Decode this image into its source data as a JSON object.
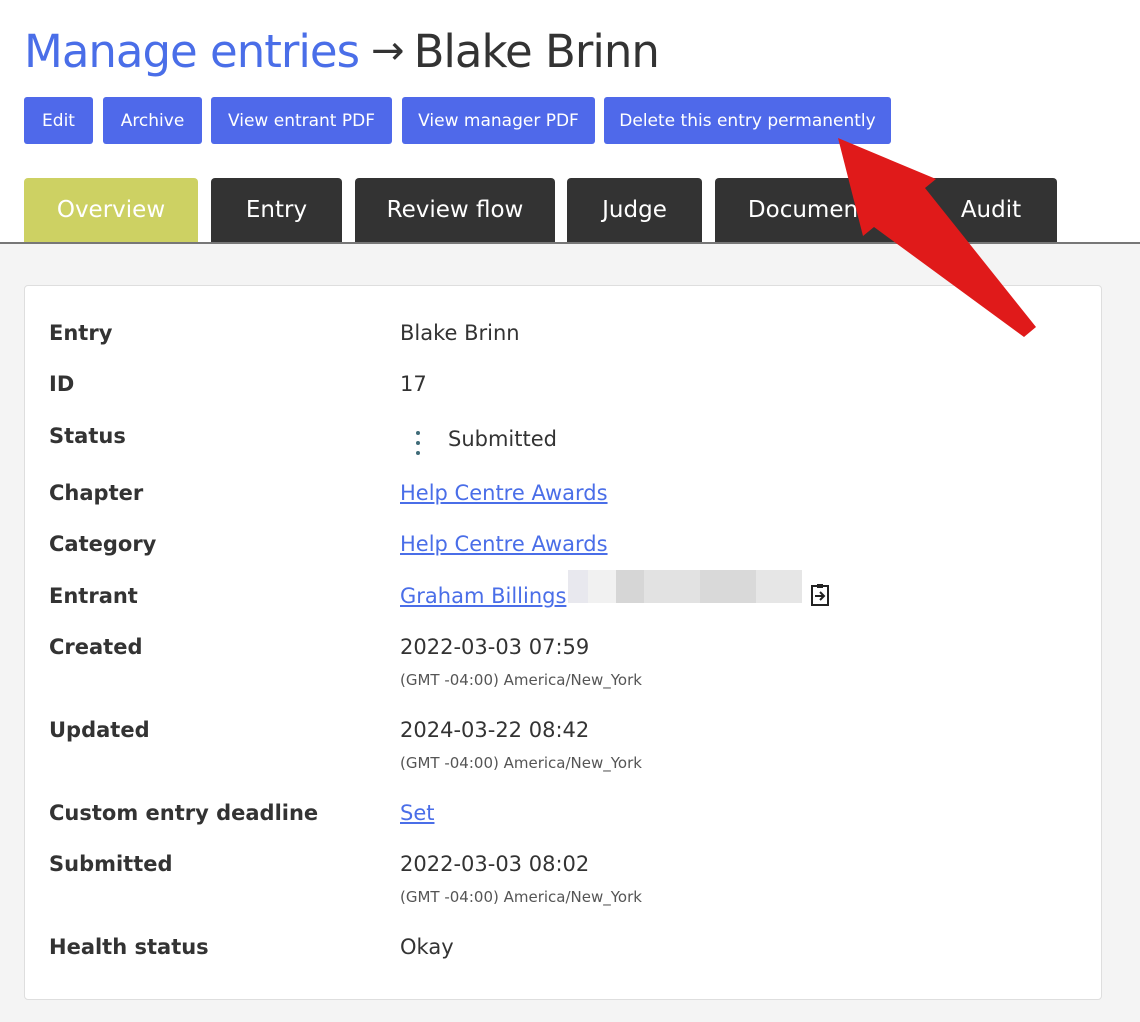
{
  "header": {
    "breadcrumb_label": "Manage entries",
    "separator": "→",
    "entry_name": "Blake Brinn"
  },
  "toolbar": {
    "edit_label": "Edit",
    "archive_label": "Archive",
    "entrant_pdf_label": "View entrant PDF",
    "manager_pdf_label": "View manager PDF",
    "delete_label": "Delete this entry permanently"
  },
  "tabs": [
    {
      "label": "Overview",
      "active": true
    },
    {
      "label": "Entry",
      "active": false
    },
    {
      "label": "Review flow",
      "active": false
    },
    {
      "label": "Judge",
      "active": false
    },
    {
      "label": "Documents",
      "active": false
    },
    {
      "label": "Audit",
      "active": false
    }
  ],
  "overview": {
    "entry": {
      "label": "Entry",
      "value": "Blake Brinn"
    },
    "id": {
      "label": "ID",
      "value": "17"
    },
    "status": {
      "label": "Status",
      "value": "Submitted",
      "menu_icon": "kebab-menu-icon"
    },
    "chapter": {
      "label": "Chapter",
      "value": "Help Centre Awards"
    },
    "category": {
      "label": "Category",
      "value": "Help Centre Awards"
    },
    "entrant": {
      "label": "Entrant",
      "value": "Graham Billings",
      "action_icon": "login-as-user-icon"
    },
    "created": {
      "label": "Created",
      "value": "2022-03-03 07:59",
      "timezone": "(GMT -04:00) America/New_York"
    },
    "updated": {
      "label": "Updated",
      "value": "2024-03-22 08:42",
      "timezone": "(GMT -04:00) America/New_York"
    },
    "custom_deadline": {
      "label": "Custom entry deadline",
      "value": "Set"
    },
    "submitted": {
      "label": "Submitted",
      "value": "2022-03-03 08:02",
      "timezone": "(GMT -04:00) America/New_York"
    },
    "health": {
      "label": "Health status",
      "value": "Okay"
    }
  },
  "colors": {
    "link": "#4a6ee8",
    "button": "#4f69ea",
    "tab": "#333333",
    "tab_active": "#cdd163",
    "annotation_arrow": "#e01a1a"
  }
}
